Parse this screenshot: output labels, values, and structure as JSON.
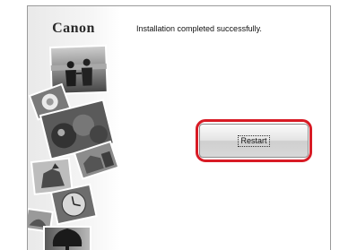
{
  "window": {
    "brand_logo": "Canon",
    "status_message": "Installation completed successfully.",
    "restart_label": "Restart"
  },
  "colors": {
    "highlight_ring": "#d81b25",
    "button_face": "#dcdcdc",
    "side_panel": "#eeeeee"
  }
}
